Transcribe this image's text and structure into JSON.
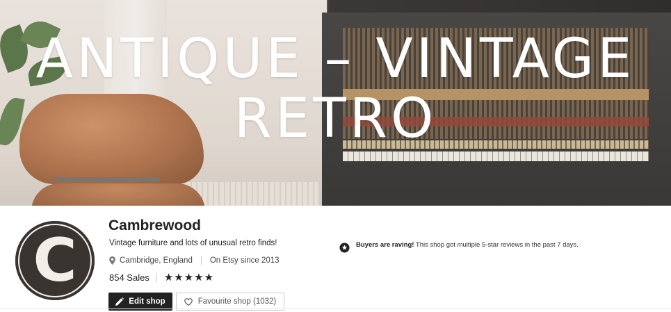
{
  "banner": {
    "title_line1": "ANTIQUE – VINTAGE",
    "title_line2": "RETRO"
  },
  "shop": {
    "logo_letter": "C",
    "name": "Cambrewood",
    "tagline": "Vintage furniture and lots of unusual retro finds!",
    "location": "Cambridge, England",
    "since": "On Etsy since 2013",
    "sales": "854 Sales",
    "stars": "★★★★★",
    "rating": 5
  },
  "actions": {
    "edit_label": "Edit shop",
    "favourite_label": "Favourite shop (1032)"
  },
  "rave": {
    "heading": "Buyers are raving!",
    "text": " This shop got multiple 5-star reviews in the past 7 days."
  },
  "icons": {
    "location": "pin-icon",
    "edit": "pencil-icon",
    "favourite": "heart-icon",
    "rave": "star-badge-icon"
  }
}
